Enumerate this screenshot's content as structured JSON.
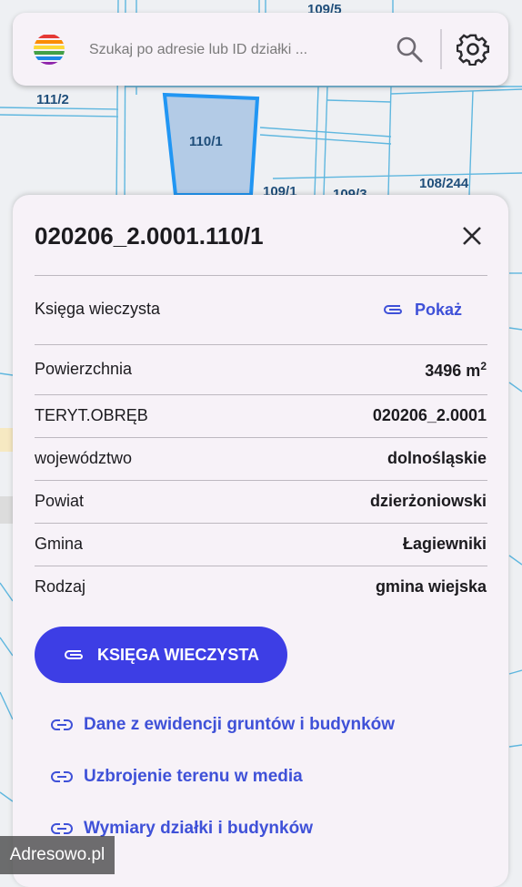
{
  "map": {
    "parcel_labels": [
      "109/5",
      "111/2",
      "110/1",
      "109/1",
      "109/3",
      "108/244"
    ]
  },
  "search": {
    "placeholder": "Szukaj po adresie lub ID działki ...",
    "value": ""
  },
  "icons": {
    "logo": "rainbow-stripes-logo",
    "search": "search-icon",
    "settings": "gear-icon",
    "close": "close-icon",
    "link": "link-icon",
    "attachment": "paperclip-icon"
  },
  "colors": {
    "accent": "#3d3ee5",
    "link": "#3f51d8",
    "sheet_bg": "#f7f2f8",
    "selected_parcel_fill": "#b3cbe6",
    "selected_parcel_border": "#2196f3"
  },
  "parcel": {
    "id": "020206_2.0001.110/1",
    "land_register": {
      "label": "Księga wieczysta",
      "action": "Pokaż"
    },
    "rows": [
      {
        "label": "Powierzchnia",
        "value": "3496 m",
        "sup": "2"
      },
      {
        "label": "TERYT.OBRĘB",
        "value": "020206_2.0001"
      },
      {
        "label": "województwo",
        "value": "dolnośląskie"
      },
      {
        "label": "Powiat",
        "value": "dzierżoniowski"
      },
      {
        "label": "Gmina",
        "value": "Łagiewniki"
      },
      {
        "label": "Rodzaj",
        "value": "gmina wiejska"
      }
    ]
  },
  "actions": {
    "primary": "KSIĘGA WIECZYSTA",
    "links": [
      "Dane z ewidencji gruntów i budynków",
      "Uzbrojenie terenu w media",
      "Wymiary działki i budynków"
    ]
  },
  "watermark": "Adresowo.pl"
}
